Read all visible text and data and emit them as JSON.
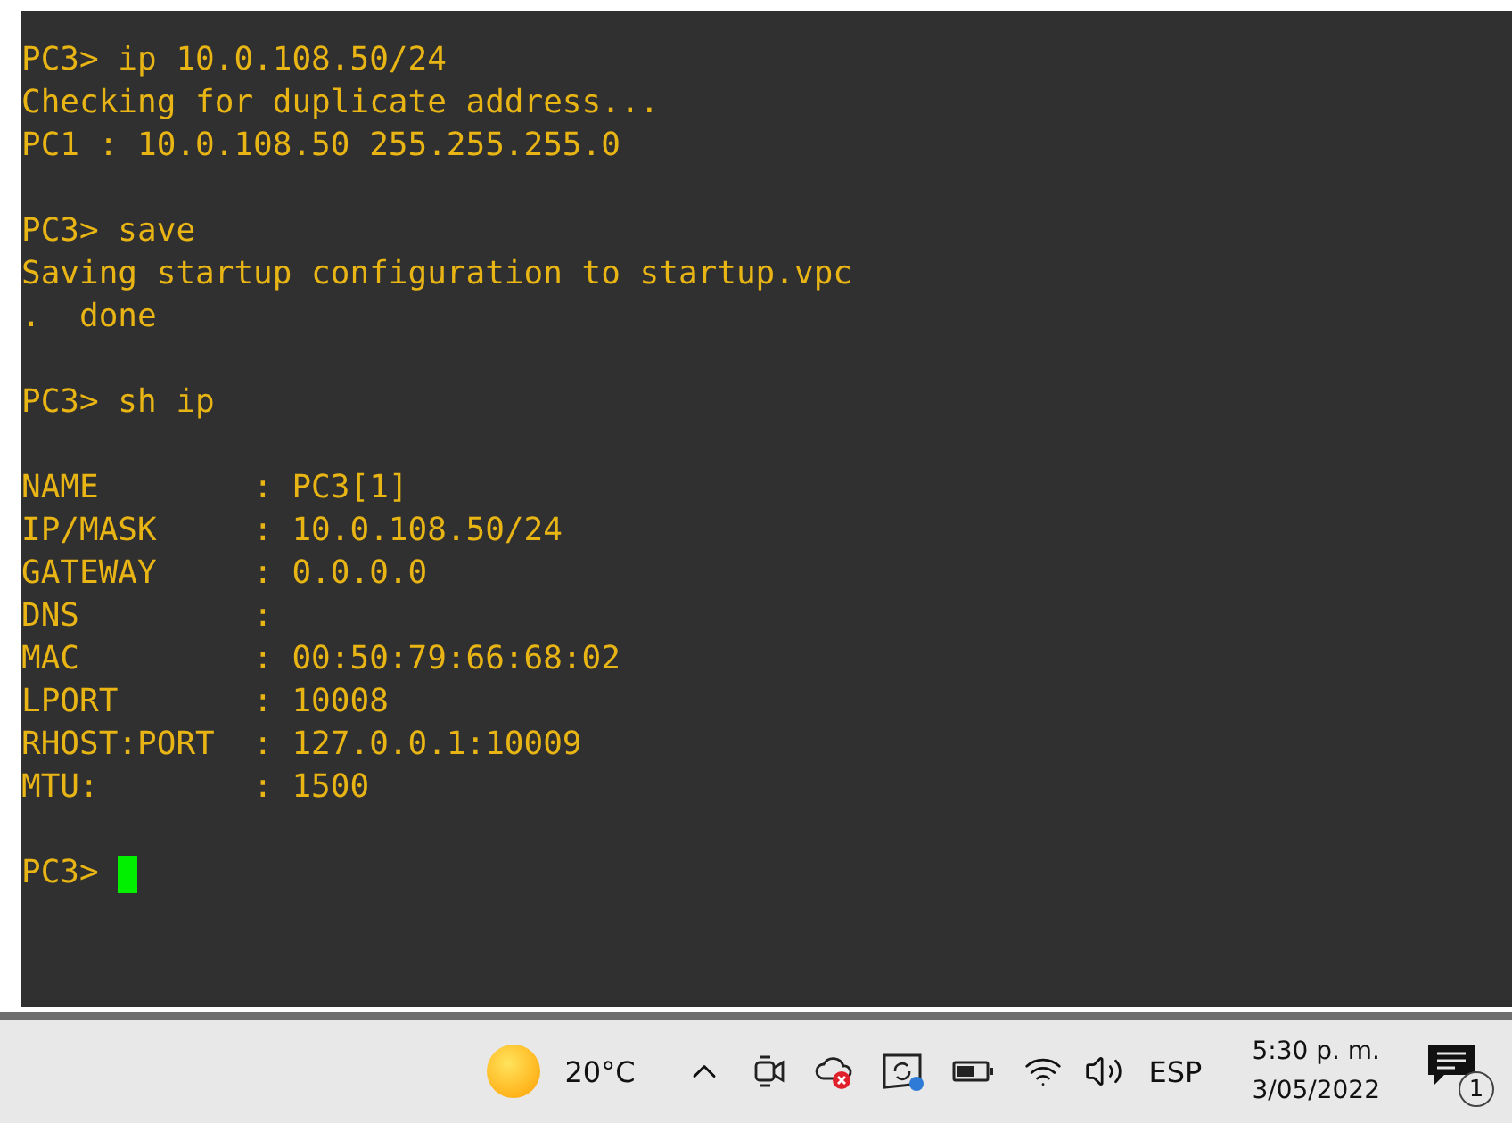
{
  "terminal": {
    "blocks": [
      [
        "PC3> ip 10.0.108.50/24",
        "Checking for duplicate address...",
        "PC1 : 10.0.108.50 255.255.255.0"
      ],
      [
        "PC3> save",
        "Saving startup configuration to startup.vpc",
        ".  done"
      ],
      [
        "PC3> sh ip"
      ],
      [
        "NAME        : PC3[1]",
        "IP/MASK     : 10.0.108.50/24",
        "GATEWAY     : 0.0.0.0",
        "DNS         :",
        "MAC         : 00:50:79:66:68:02",
        "LPORT       : 10008",
        "RHOST:PORT  : 127.0.0.1:10009",
        "MTU:        : 1500"
      ]
    ],
    "prompt": "PC3>"
  },
  "taskbar": {
    "weather": "20°C",
    "language": "ESP",
    "time": "5:30 p. m.",
    "date": "3/05/2022",
    "notification_count": "1"
  }
}
